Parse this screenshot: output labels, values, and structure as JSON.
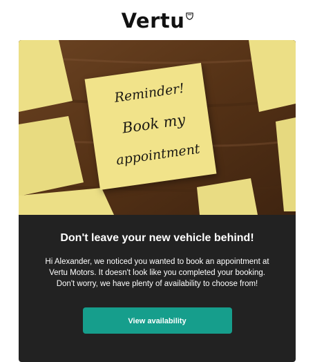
{
  "header": {
    "logo_text": "Vertu",
    "logo_mark_icon": "shield-icon"
  },
  "hero": {
    "image_description_icon": "sticky-note-image",
    "note_lines": [
      "Reminder!",
      "Book my",
      "appointment"
    ]
  },
  "content": {
    "headline": "Don't leave your new vehicle behind!",
    "body": "Hi Alexander, we noticed you wanted to book an appointment at Vertu Motors. It doesn't look like you completed your booking. Don't worry, we have plenty of availability to choose from!",
    "cta_label": "View availability"
  },
  "colors": {
    "card_background": "#222222",
    "cta_background": "#169e8c",
    "note_yellow": "#f1e38a",
    "wood": "#5a3719"
  }
}
